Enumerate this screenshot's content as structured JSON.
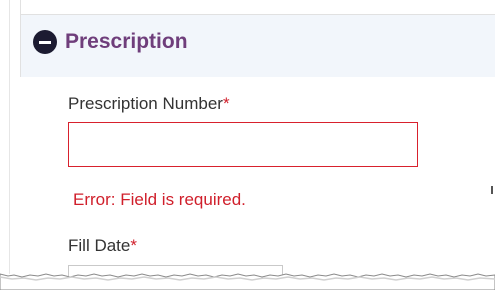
{
  "section": {
    "title": "Prescription",
    "toggle_icon": "minus-circle-icon",
    "title_color": "#6f3e7b",
    "header_bg": "#f2f6fb"
  },
  "fields": {
    "prescription_number": {
      "label": "Prescription Number",
      "required_mark": "*",
      "value": "",
      "error": "Error: Field is required."
    },
    "fill_date": {
      "label": "Fill Date",
      "required_mark": "*"
    }
  },
  "colors": {
    "error": "#d01f2b",
    "label": "#333333"
  }
}
